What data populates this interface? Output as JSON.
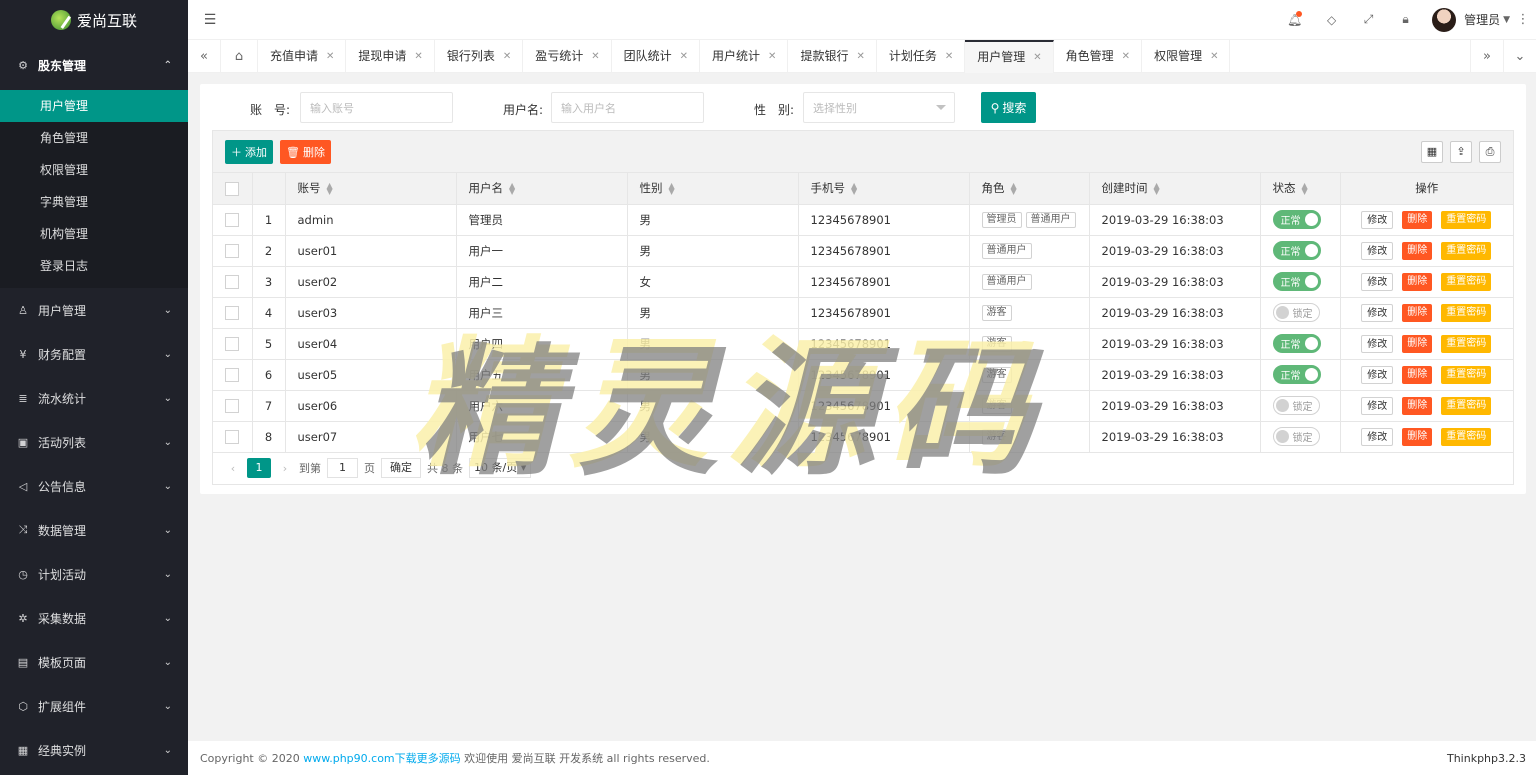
{
  "app": {
    "name": "爱尚互联"
  },
  "sidebar": {
    "open_group": {
      "label": "股东管理",
      "icon": "gear-icon"
    },
    "sub_items": [
      {
        "label": "用户管理",
        "active": true
      },
      {
        "label": "角色管理"
      },
      {
        "label": "权限管理"
      },
      {
        "label": "字典管理"
      },
      {
        "label": "机构管理"
      },
      {
        "label": "登录日志"
      }
    ],
    "groups": [
      {
        "label": "用户管理",
        "icon": "user-icon"
      },
      {
        "label": "财务配置",
        "icon": "yen-icon"
      },
      {
        "label": "流水统计",
        "icon": "list-icon"
      },
      {
        "label": "活动列表",
        "icon": "gift-icon"
      },
      {
        "label": "公告信息",
        "icon": "speaker-icon"
      },
      {
        "label": "数据管理",
        "icon": "shuffle-icon"
      },
      {
        "label": "计划活动",
        "icon": "clock-icon"
      },
      {
        "label": "采集数据",
        "icon": "bug-icon"
      },
      {
        "label": "模板页面",
        "icon": "template-icon"
      },
      {
        "label": "扩展组件",
        "icon": "cube-icon"
      },
      {
        "label": "经典实例",
        "icon": "apps-icon"
      }
    ]
  },
  "header": {
    "admin_name": "管理员"
  },
  "tabs": [
    {
      "label": "充值申请"
    },
    {
      "label": "提现申请"
    },
    {
      "label": "银行列表"
    },
    {
      "label": "盈亏统计"
    },
    {
      "label": "团队统计"
    },
    {
      "label": "用户统计"
    },
    {
      "label": "提款银行"
    },
    {
      "label": "计划任务"
    },
    {
      "label": "用户管理",
      "active": true
    },
    {
      "label": "角色管理"
    },
    {
      "label": "权限管理"
    }
  ],
  "search": {
    "account_label": "账　号:",
    "account_placeholder": "输入账号",
    "username_label": "用户名:",
    "username_placeholder": "输入用户名",
    "gender_label": "性　别:",
    "gender_placeholder": "选择性别",
    "button": "搜索"
  },
  "toolbar": {
    "add": "添加",
    "delete": "删除"
  },
  "table": {
    "headers": {
      "account": "账号",
      "username": "用户名",
      "gender": "性别",
      "phone": "手机号",
      "role": "角色",
      "created": "创建时间",
      "status": "状态",
      "actions": "操作"
    },
    "rows": [
      {
        "no": "1",
        "account": "admin",
        "username": "管理员",
        "gender": "男",
        "phone": "12345678901",
        "roles": [
          "管理员",
          "普通用户"
        ],
        "created": "2019-03-29 16:38:03",
        "status": "正常",
        "on": true
      },
      {
        "no": "2",
        "account": "user01",
        "username": "用户一",
        "gender": "男",
        "phone": "12345678901",
        "roles": [
          "普通用户"
        ],
        "created": "2019-03-29 16:38:03",
        "status": "正常",
        "on": true
      },
      {
        "no": "3",
        "account": "user02",
        "username": "用户二",
        "gender": "女",
        "phone": "12345678901",
        "roles": [
          "普通用户"
        ],
        "created": "2019-03-29 16:38:03",
        "status": "正常",
        "on": true
      },
      {
        "no": "4",
        "account": "user03",
        "username": "用户三",
        "gender": "男",
        "phone": "12345678901",
        "roles": [
          "游客"
        ],
        "created": "2019-03-29 16:38:03",
        "status": "锁定",
        "on": false
      },
      {
        "no": "5",
        "account": "user04",
        "username": "用户四",
        "gender": "男",
        "phone": "12345678901",
        "roles": [
          "游客"
        ],
        "created": "2019-03-29 16:38:03",
        "status": "正常",
        "on": true
      },
      {
        "no": "6",
        "account": "user05",
        "username": "用户五",
        "gender": "男",
        "phone": "12345678901",
        "roles": [
          "游客"
        ],
        "created": "2019-03-29 16:38:03",
        "status": "正常",
        "on": true
      },
      {
        "no": "7",
        "account": "user06",
        "username": "用户六",
        "gender": "男",
        "phone": "12345678901",
        "roles": [
          "游客"
        ],
        "created": "2019-03-29 16:38:03",
        "status": "锁定",
        "on": false
      },
      {
        "no": "8",
        "account": "user07",
        "username": "用户七",
        "gender": "男",
        "phone": "12345678901",
        "roles": [
          "游客"
        ],
        "created": "2019-03-29 16:38:03",
        "status": "锁定",
        "on": false
      }
    ],
    "actions": {
      "edit": "修改",
      "delete": "删除",
      "reset": "重置密码"
    }
  },
  "pager": {
    "current": "1",
    "goto_label": "到第",
    "goto_value": "1",
    "page_unit": "页",
    "confirm": "确定",
    "total": "共 8 条",
    "page_size": "10 条/页"
  },
  "footer": {
    "copyright": "Copyright © 2020",
    "link": "www.php90.com下载更多源码",
    "tail": "欢迎使用 爱尚互联 开发系统 all rights reserved.",
    "version": "Thinkphp3.2.3"
  },
  "watermark": "精灵源码",
  "colors": {
    "primary": "#009688",
    "danger": "#ff5722",
    "warm": "#ffb800",
    "sidebar": "#20222a",
    "switch_on": "#5fb878"
  }
}
